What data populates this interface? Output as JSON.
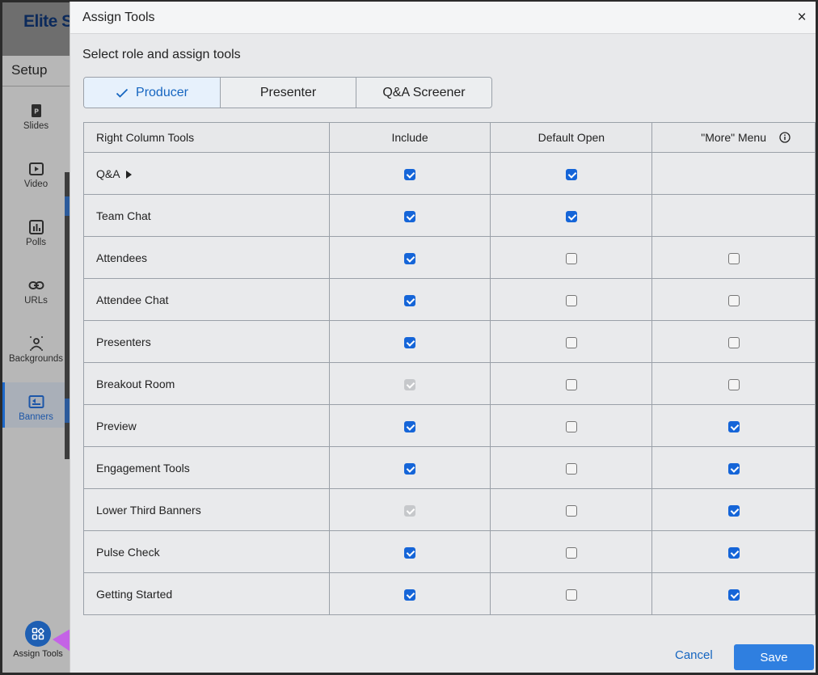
{
  "app": {
    "brand": "Elite S",
    "setup_label": "Setup",
    "sidebar": [
      {
        "label": "Slides",
        "icon": "slides-icon"
      },
      {
        "label": "Video",
        "icon": "video-icon"
      },
      {
        "label": "Polls",
        "icon": "polls-icon"
      },
      {
        "label": "URLs",
        "icon": "link-icon"
      },
      {
        "label": "Backgrounds",
        "icon": "backgrounds-icon"
      },
      {
        "label": "Banners",
        "icon": "banners-icon",
        "active": true
      }
    ],
    "assign_tools_label": "Assign Tools",
    "accent_color": "#1e5fb3",
    "arrow_color": "#c463e6"
  },
  "modal": {
    "title": "Assign Tools",
    "close_symbol": "×",
    "subtitle": "Select role and assign tools",
    "roles": [
      {
        "label": "Producer",
        "selected": true
      },
      {
        "label": "Presenter",
        "selected": false
      },
      {
        "label": "Q&A Screener",
        "selected": false
      }
    ],
    "table": {
      "headers": [
        "Right Column Tools",
        "Include",
        "Default Open",
        "\"More\" Menu"
      ],
      "rows": [
        {
          "name": "Q&A",
          "expandable": true,
          "include": "on",
          "default_open": "on",
          "more": "none"
        },
        {
          "name": "Team Chat",
          "include": "on",
          "default_open": "on",
          "more": "none"
        },
        {
          "name": "Attendees",
          "include": "on",
          "default_open": "off",
          "more": "off"
        },
        {
          "name": "Attendee Chat",
          "include": "on",
          "default_open": "off",
          "more": "off"
        },
        {
          "name": "Presenters",
          "include": "on",
          "default_open": "off",
          "more": "off"
        },
        {
          "name": "Breakout Room",
          "include": "dis",
          "default_open": "off",
          "more": "off"
        },
        {
          "name": "Preview",
          "include": "on",
          "default_open": "off",
          "more": "on"
        },
        {
          "name": "Engagement Tools",
          "include": "on",
          "default_open": "off",
          "more": "on"
        },
        {
          "name": "Lower Third Banners",
          "include": "dis",
          "default_open": "off",
          "more": "on"
        },
        {
          "name": "Pulse Check",
          "include": "on",
          "default_open": "off",
          "more": "on"
        },
        {
          "name": "Getting Started",
          "include": "on",
          "default_open": "off",
          "more": "on"
        }
      ]
    },
    "cancel_label": "Cancel",
    "save_label": "Save",
    "primary_color": "#2f7fe0",
    "checkbox_color": "#1565d8"
  }
}
